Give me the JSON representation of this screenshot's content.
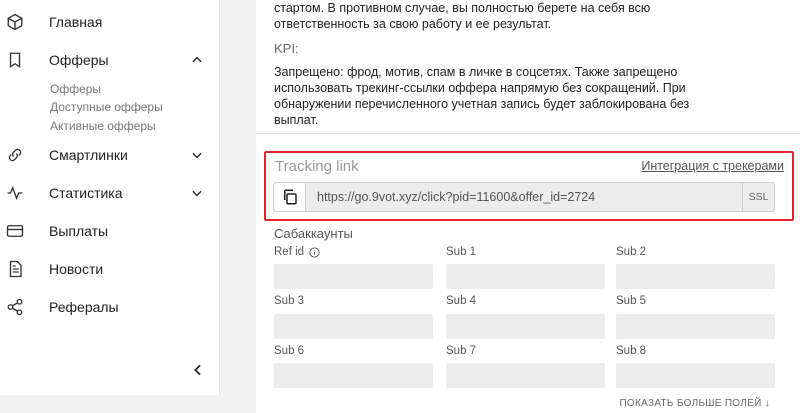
{
  "sidebar": {
    "items": [
      {
        "label": "Главная",
        "icon": "cube-icon"
      },
      {
        "label": "Офферы",
        "icon": "bookmark-icon"
      },
      {
        "label": "Смартлинки",
        "icon": "link-icon"
      },
      {
        "label": "Статистика",
        "icon": "pulse-icon"
      },
      {
        "label": "Выплаты",
        "icon": "card-icon"
      },
      {
        "label": "Новости",
        "icon": "document-icon"
      },
      {
        "label": "Рефералы",
        "icon": "share-icon"
      }
    ],
    "offers_sub": [
      "Офферы",
      "Доступные офферы",
      "Активные офферы"
    ]
  },
  "main": {
    "desc_lines": [
      "стартом. В противном случае, вы полностью берете на себя всю",
      "ответственность за свою работу и ее результат."
    ],
    "kpi_label": "KPI:",
    "restriction_lines": [
      "Запрещено: фрод, мотив, спам в личке в соцсетях. Также запрещено",
      "использовать трекинг-ссылки оффера напрямую без сокращений. При",
      "обнаружении перечисленного учетная запись будет заблокирована без",
      "выплат."
    ],
    "tracking": {
      "title": "Tracking link",
      "integration_link": "Интеграция с трекерами",
      "url": "https://go.9vot.xyz/click?pid=11600&offer_id=2724",
      "ssl": "SSL"
    },
    "subaccounts": {
      "title": "Сабаккаунты",
      "labels": [
        "Ref id",
        "Sub 1",
        "Sub 2",
        "Sub 3",
        "Sub 4",
        "Sub 5",
        "Sub 6",
        "Sub 7",
        "Sub 8"
      ],
      "values": [
        "",
        "",
        "",
        "",
        "",
        "",
        "",
        "",
        ""
      ]
    },
    "show_more": "ПОКАЗАТЬ БОЛЬШЕ ПОЛЕЙ"
  },
  "colors": {
    "highlight": "#e4242c",
    "field_bg": "#ececec"
  }
}
